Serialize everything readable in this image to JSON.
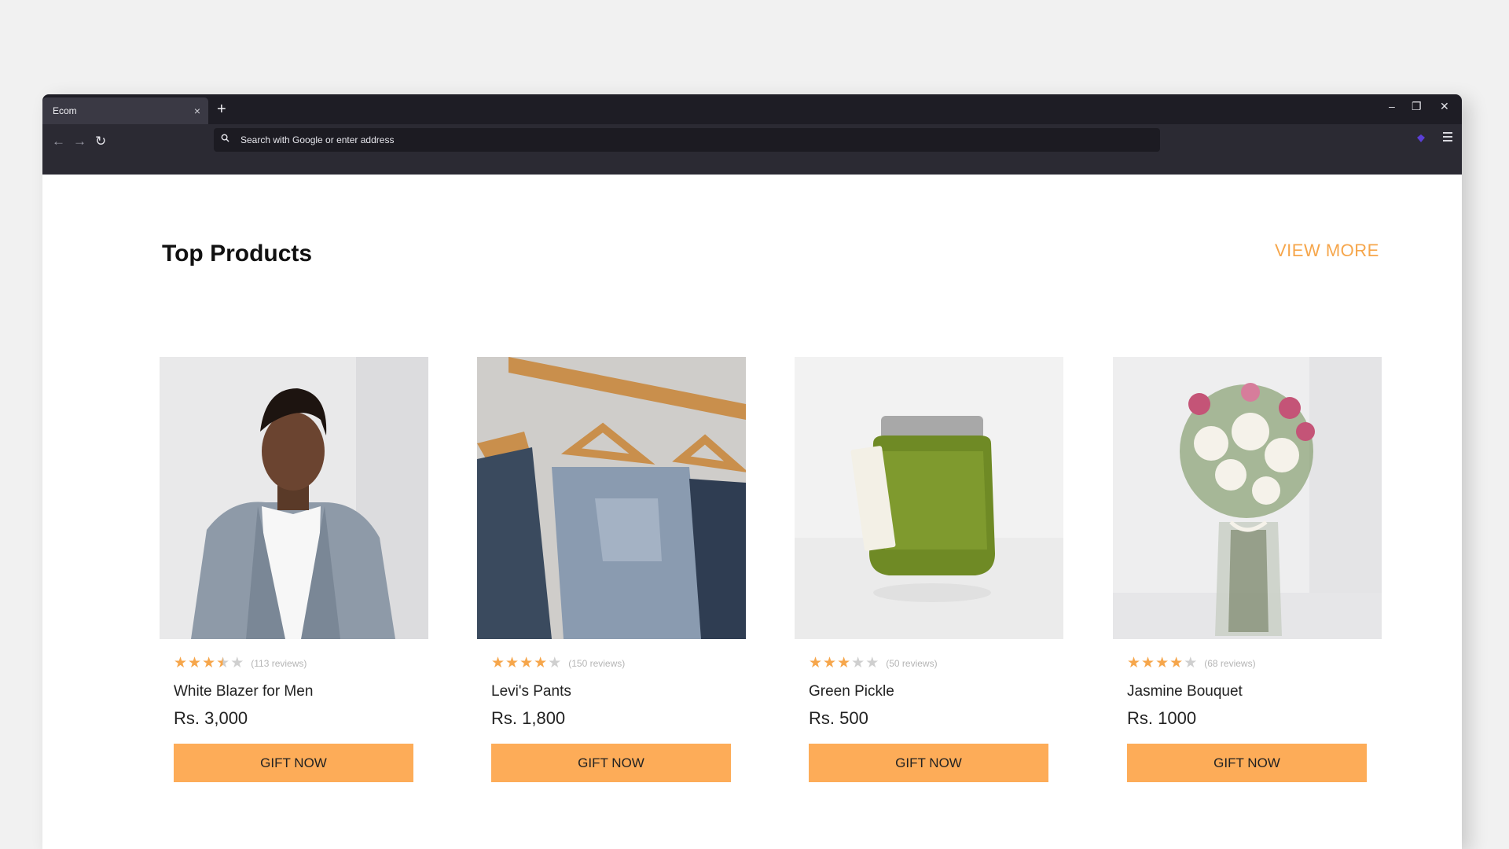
{
  "browser": {
    "tab_title": "Ecom",
    "tab_close": "×",
    "new_tab": "+",
    "back": "←",
    "forward": "→",
    "reload": "↻",
    "minimize": "–",
    "restore": "❐",
    "close": "✕",
    "address_placeholder": "Search with Google or enter address",
    "theme": "#1e1d25",
    "toolbar_color": "#2b2a33"
  },
  "section": {
    "title": "Top Products",
    "view_more": "VIEW MORE",
    "accent": "#f6a64b",
    "button_color": "#fdac58"
  },
  "products": [
    {
      "name": "White Blazer for Men",
      "price": "Rs. 3,000",
      "rating": 3.5,
      "reviews": "(113 reviews)",
      "button": "GIFT NOW",
      "image": "man-in-grey-blazer"
    },
    {
      "name": "Levi's Pants",
      "price": "Rs. 1,800",
      "rating": 4,
      "reviews": "(150 reviews)",
      "button": "GIFT NOW",
      "image": "jeans-on-wooden-hangers"
    },
    {
      "name": "Green Pickle",
      "price": "Rs. 500",
      "rating": 3,
      "reviews": "(50 reviews)",
      "button": "GIFT NOW",
      "image": "green-pickle-jar-with-tag"
    },
    {
      "name": "Jasmine Bouquet",
      "price": "Rs. 1000",
      "rating": 4,
      "reviews": "(68 reviews)",
      "button": "GIFT NOW",
      "image": "white-roses-bouquet-in-vase"
    }
  ]
}
